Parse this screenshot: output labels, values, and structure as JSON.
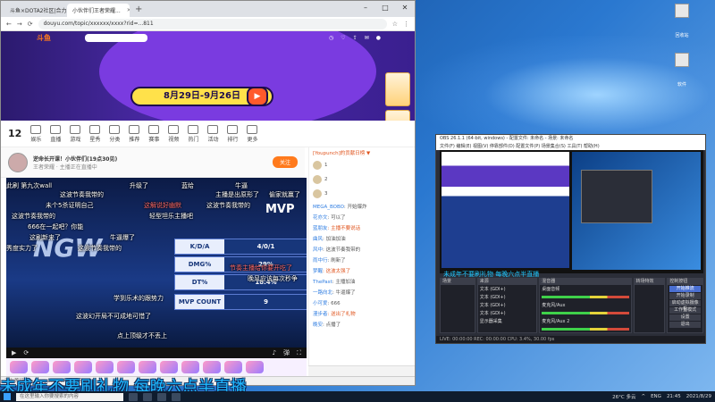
{
  "browser": {
    "tabs": [
      {
        "label": "斗鱼×DOTA2社区|合力人...",
        "active": false
      },
      {
        "label": "小伙伴们王者荣耀...",
        "active": true
      }
    ],
    "url": "douyu.com/topic/xxxxxx/xxxx?rid=...811",
    "window_controls": [
      "–",
      "□",
      "✕"
    ]
  },
  "site": {
    "logo": "斗鱼",
    "banner_date": "8月29日-9月26日",
    "play_symbol": "▶"
  },
  "room_bar": {
    "count": "12",
    "items": [
      "娱乐",
      "直播",
      "游戏",
      "星秀",
      "分类",
      "推荐",
      "赛事",
      "视频",
      "热门",
      "活动",
      "排行",
      "更多"
    ]
  },
  "streamer": {
    "name": "逆命长开课！小伙伴们(19点30见)",
    "meta": "王者荣耀 · 主播正在直播中",
    "follow_label": "关注"
  },
  "video": {
    "watermark": "NGW",
    "mvp": "MVP",
    "stats": [
      {
        "label": "K/D/A",
        "value": "4/0/1"
      },
      {
        "label": "DMG%",
        "value": "29%"
      },
      {
        "label": "DT%",
        "value": "18.4%"
      },
      {
        "label": "MVP COUNT",
        "value": "9"
      }
    ],
    "danmaku": [
      {
        "text": "此刷 第九次wall",
        "red": false
      },
      {
        "text": "升级了",
        "red": false
      },
      {
        "text": "蓝给",
        "red": false
      },
      {
        "text": "牛逼",
        "red": false
      },
      {
        "text": "这波节奏我带的",
        "red": false
      },
      {
        "text": "未个5杀证明自己",
        "red": false
      },
      {
        "text": "主播是出原形了",
        "red": false
      },
      {
        "text": "偷家就赢了",
        "red": false
      },
      {
        "text": "这解说好幽默",
        "red": true
      },
      {
        "text": "这波节奏我带的",
        "red": false
      },
      {
        "text": "轻型坦乐主播吧",
        "red": false
      },
      {
        "text": "666在一起吧？你能",
        "red": false
      },
      {
        "text": "这波节奏我带的",
        "red": false
      },
      {
        "text": "这刷新来了",
        "red": false
      },
      {
        "text": "牛逼爆了",
        "red": false
      },
      {
        "text": "秀度实力了",
        "red": false
      },
      {
        "text": "这波节奏我带的",
        "red": false
      },
      {
        "text": "节奏主播给你要开吃了",
        "red": true
      },
      {
        "text": "晚风应该每次秒争",
        "red": false
      },
      {
        "text": "学到乐术的跟势力",
        "red": false
      },
      {
        "text": "这波幻开局不可成地可惜了",
        "red": false
      },
      {
        "text": "点上顶级才不丢上",
        "red": false
      }
    ],
    "controls": [
      "▶",
      "⟳",
      "♪",
      "弹",
      "⛶"
    ]
  },
  "chat": {
    "header": "[Youpunch]的贡献日榜 ▼",
    "ranks": [
      "1",
      "2",
      "3"
    ],
    "rows": [
      {
        "user": "MEGA_BOBO",
        "text": "开始爆炸",
        "hi": false
      },
      {
        "user": "花亦文",
        "text": "可以了",
        "hi": false
      },
      {
        "user": "蓝朋友",
        "text": "主播不要说话",
        "hi": true
      },
      {
        "user": "曲风",
        "text": "加油加油",
        "hi": false
      },
      {
        "user": "风中",
        "text": "这波节奏我带的",
        "hi": false
      },
      {
        "user": "雨中行",
        "text": "刷新了",
        "hi": false
      },
      {
        "user": "梦醒",
        "text": "这波太强了",
        "hi": true
      },
      {
        "user": "ThePast",
        "text": "主播加油",
        "hi": false
      },
      {
        "user": "一路向北",
        "text": "牛逼爆了",
        "hi": false
      },
      {
        "user": "小可爱",
        "text": "666",
        "hi": false
      },
      {
        "user": "漫步者",
        "text": "送出了礼物",
        "hi": true
      },
      {
        "user": "晚安",
        "text": "点播了",
        "hi": false
      }
    ]
  },
  "statusbar": "正在等待 sta.douyucdn.cn 的响应...",
  "obs": {
    "title": "OBS 26.1.1 (64-bit, windows) - 配置文件: 未命名 - 场景: 未命名",
    "menu": "文件(F) 编辑(E) 视图(V) 停靠部件(D) 配置文件(P) 场景集合(S) 工具(T) 帮助(H)",
    "overlay_text": "未成年不要刷礼物 每晚六点半直播",
    "panel_titles": [
      "场景",
      "来源",
      "混音器",
      "转场特效",
      "控制按钮"
    ],
    "sources": [
      "文本 (GDI+)",
      "文本 (GDI+)",
      "文本 (GDI+)",
      "文本 (GDI+)",
      "显示器采集"
    ],
    "mixer": [
      "桌面音频",
      "麦克风/Aux",
      "麦克风/Aux 2"
    ],
    "buttons": [
      {
        "label": "开始推流",
        "highlight": true
      },
      {
        "label": "开始录制",
        "highlight": false
      },
      {
        "label": "启动虚拟摄像机",
        "highlight": false
      },
      {
        "label": "工作室模式",
        "highlight": false
      },
      {
        "label": "设置",
        "highlight": false
      },
      {
        "label": "退出",
        "highlight": false
      }
    ],
    "statusbar": "LIVE: 00:00:00  REC: 00:00:00  CPU: 3.4%, 30.00 fps"
  },
  "caption": "未成年不要刷礼物 每晚六点半直播",
  "taskbar": {
    "search": "在这里输入你要搜索的内容",
    "tray": [
      "26°C 多云",
      "^",
      "ENG",
      "21:45",
      "2021/8/29"
    ]
  },
  "desktop_icons": [
    "回收站",
    "软件"
  ],
  "colors": {
    "caption": "#20b8ff",
    "brand": "#ff7a1c",
    "obs_bg": "#2b2e38"
  }
}
